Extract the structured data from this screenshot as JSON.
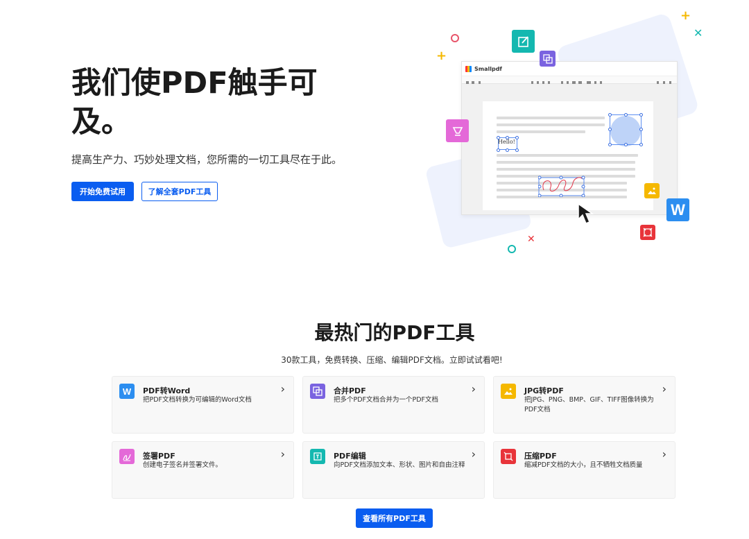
{
  "hero": {
    "title": "我们使PDF触手可及。",
    "subtitle": "提高生产力、巧妙处理文档，您所需的一切工具尽在于此。",
    "cta_primary": "开始免费试用",
    "cta_secondary": "了解全套PDF工具"
  },
  "illustration": {
    "app_name": "Smallpdf",
    "hello_text": "Hello!",
    "word_icon_letter": "W"
  },
  "tools_section": {
    "title": "最热门的PDF工具",
    "subtitle": "30款工具，免费转换、压缩、编辑PDF文档。立即试试看吧!",
    "cards": [
      {
        "title": "PDF转Word",
        "desc": "把PDF文档转换为可编辑的Word文档",
        "icon": "word-icon",
        "color": "#2c8ef0"
      },
      {
        "title": "合并PDF",
        "desc": "把多个PDF文档合并为一个PDF文档",
        "icon": "merge-icon",
        "color": "#7a63e0"
      },
      {
        "title": "JPG转PDF",
        "desc": "把JPG、PNG、BMP、GIF、TIFF图像转换为PDF文档",
        "icon": "image-icon",
        "color": "#f5b800"
      },
      {
        "title": "签署PDF",
        "desc": "创建电子签名并签署文件。",
        "icon": "signature-icon",
        "color": "#e469d8"
      },
      {
        "title": "PDF编辑",
        "desc": "向PDF文档添加文本、形状、图片和自由注释",
        "icon": "edit-icon",
        "color": "#14b8b0"
      },
      {
        "title": "压缩PDF",
        "desc": "缩减PDF文档的大小，且不牺牲文档质量",
        "icon": "compress-icon",
        "color": "#e8343a"
      }
    ],
    "see_all": "查看所有PDF工具"
  }
}
